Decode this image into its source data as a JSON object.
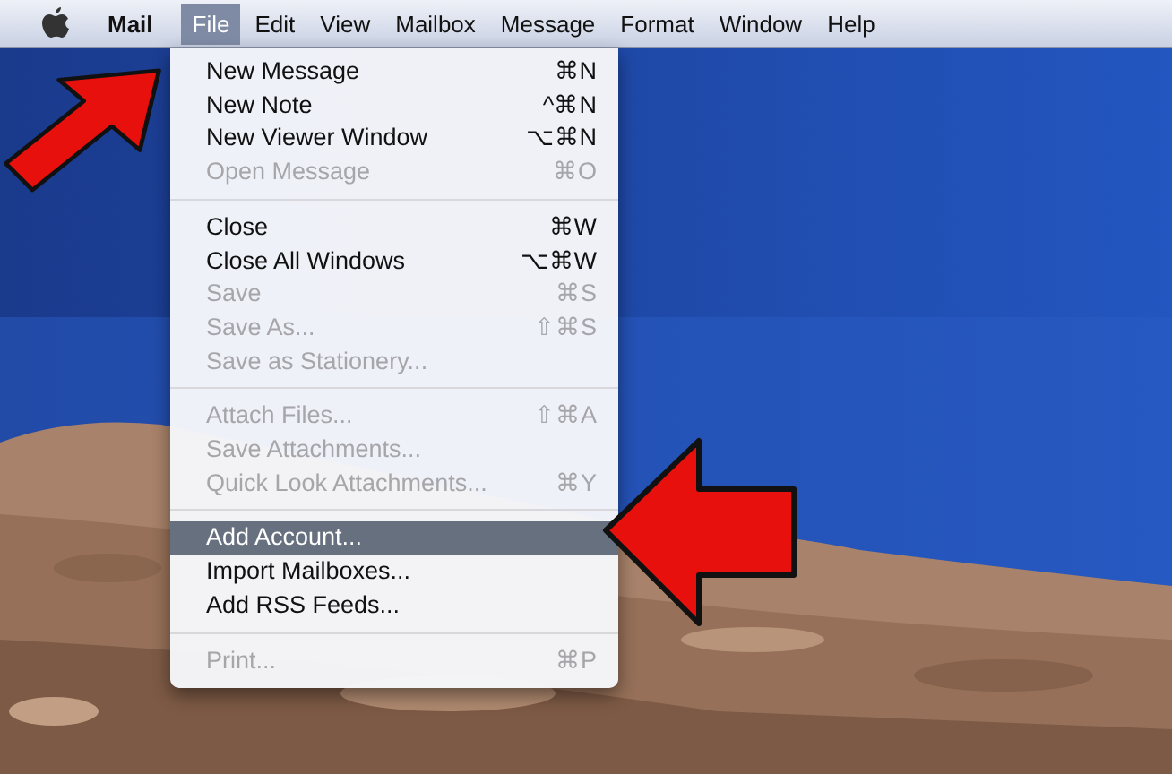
{
  "menu_bar": {
    "app_name": "Mail",
    "items": [
      {
        "label": "File",
        "selected": true
      },
      {
        "label": "Edit",
        "selected": false
      },
      {
        "label": "View",
        "selected": false
      },
      {
        "label": "Mailbox",
        "selected": false
      },
      {
        "label": "Message",
        "selected": false
      },
      {
        "label": "Format",
        "selected": false
      },
      {
        "label": "Window",
        "selected": false
      },
      {
        "label": "Help",
        "selected": false
      }
    ]
  },
  "file_menu": {
    "groups": [
      [
        {
          "label": "New Message",
          "shortcut": "⌘N",
          "disabled": false,
          "selected": false
        },
        {
          "label": "New Note",
          "shortcut": "^⌘N",
          "disabled": false,
          "selected": false
        },
        {
          "label": "New Viewer Window",
          "shortcut": "⌥⌘N",
          "disabled": false,
          "selected": false
        },
        {
          "label": "Open Message",
          "shortcut": "⌘O",
          "disabled": true,
          "selected": false
        }
      ],
      [
        {
          "label": "Close",
          "shortcut": "⌘W",
          "disabled": false,
          "selected": false
        },
        {
          "label": "Close All Windows",
          "shortcut": "⌥⌘W",
          "disabled": false,
          "selected": false
        },
        {
          "label": "Save",
          "shortcut": "⌘S",
          "disabled": true,
          "selected": false
        },
        {
          "label": "Save As...",
          "shortcut": "⇧⌘S",
          "disabled": true,
          "selected": false
        },
        {
          "label": "Save as Stationery...",
          "disabled": true,
          "selected": false
        }
      ],
      [
        {
          "label": "Attach Files...",
          "shortcut": "⇧⌘A",
          "disabled": true,
          "selected": false
        },
        {
          "label": "Save Attachments...",
          "disabled": true,
          "selected": false
        },
        {
          "label": "Quick Look Attachments...",
          "shortcut": "⌘Y",
          "disabled": true,
          "selected": false
        }
      ],
      [
        {
          "label": "Add Account...",
          "disabled": false,
          "selected": true
        },
        {
          "label": "Import Mailboxes...",
          "disabled": false,
          "selected": false
        },
        {
          "label": "Add RSS Feeds...",
          "disabled": false,
          "selected": false
        }
      ],
      [
        {
          "label": "Print...",
          "shortcut": "⌘P",
          "disabled": true,
          "selected": false
        }
      ]
    ]
  }
}
